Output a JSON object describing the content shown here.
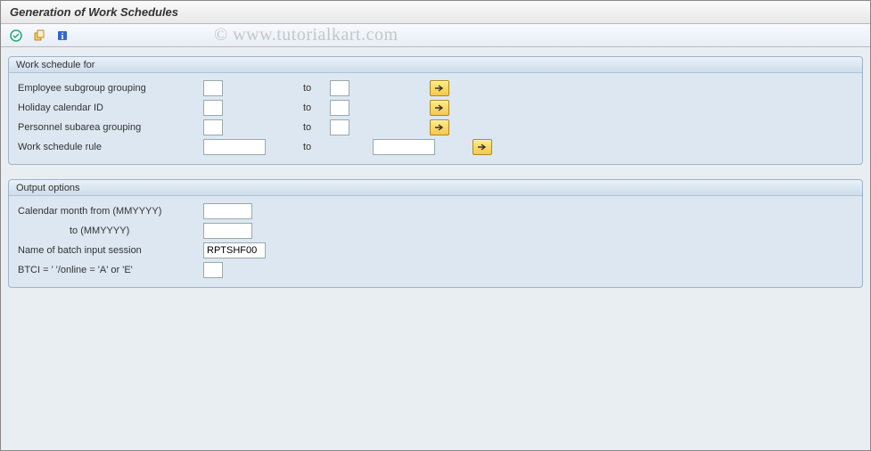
{
  "header": {
    "title": "Generation of Work Schedules"
  },
  "toolbar": {
    "icons": [
      "execute-icon",
      "copy-variant-icon",
      "info-icon"
    ]
  },
  "watermark": "© www.tutorialkart.com",
  "group_ws": {
    "title": "Work schedule for",
    "rows": [
      {
        "label": "Employee subgroup grouping",
        "from": "",
        "to_label": "to",
        "to": "",
        "type": "short"
      },
      {
        "label": "Holiday calendar ID",
        "from": "",
        "to_label": "to",
        "to": "",
        "type": "short"
      },
      {
        "label": "Personnel subarea grouping",
        "from": "",
        "to_label": "to",
        "to": "",
        "type": "short"
      },
      {
        "label": "Work schedule rule",
        "from": "",
        "to_label": "to",
        "to": "",
        "type": "medium"
      }
    ]
  },
  "group_out": {
    "title": "Output options",
    "rows": [
      {
        "label": "Calendar month from (MMYYYY)",
        "value": "",
        "type": "month"
      },
      {
        "label": "to (MMYYYY)",
        "value": "",
        "type": "month",
        "indent": true
      },
      {
        "label": "Name of batch input session",
        "value": "RPTSHF00",
        "type": "medium"
      },
      {
        "label": "BTCI = ' '/online = 'A' or 'E'",
        "value": "",
        "type": "short"
      }
    ]
  }
}
